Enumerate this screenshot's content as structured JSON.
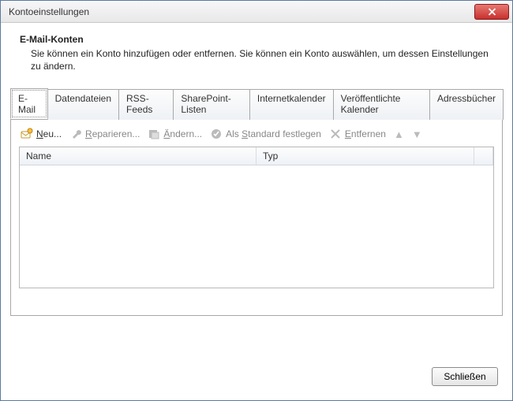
{
  "window": {
    "title": "Kontoeinstellungen"
  },
  "header": {
    "title": "E-Mail-Konten",
    "text": "Sie können ein Konto hinzufügen oder entfernen. Sie können ein Konto auswählen, um dessen Einstellungen zu ändern."
  },
  "tabs": [
    {
      "label": "E-Mail",
      "active": true
    },
    {
      "label": "Datendateien"
    },
    {
      "label": "RSS-Feeds"
    },
    {
      "label": "SharePoint-Listen"
    },
    {
      "label": "Internetkalender"
    },
    {
      "label": "Veröffentlichte Kalender"
    },
    {
      "label": "Adressbücher"
    }
  ],
  "toolbar": {
    "new": "Neu...",
    "repair": "Reparieren...",
    "change": "Ändern...",
    "default": "Als Standard festlegen",
    "remove": "Entfernen"
  },
  "list": {
    "col_name": "Name",
    "col_type": "Typ",
    "rows": []
  },
  "footer": {
    "close": "Schließen"
  }
}
